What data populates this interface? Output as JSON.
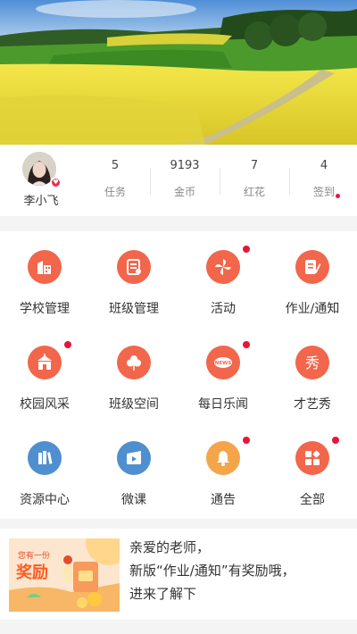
{
  "profile": {
    "name": "李小飞"
  },
  "stats": [
    {
      "value": "5",
      "label": "任务"
    },
    {
      "value": "9193",
      "label": "金币"
    },
    {
      "value": "7",
      "label": "红花"
    },
    {
      "value": "4",
      "label": "签到"
    }
  ],
  "grid": [
    {
      "label": "学校管理",
      "icon": "school-icon",
      "color": "#f2664b"
    },
    {
      "label": "班级管理",
      "icon": "class-management-icon",
      "color": "#f2664b"
    },
    {
      "label": "活动",
      "icon": "activity-pinwheel-icon",
      "color": "#f2664b",
      "dot": true
    },
    {
      "label": "作业/通知",
      "icon": "homework-icon",
      "color": "#f2664b"
    },
    {
      "label": "校园风采",
      "icon": "campus-icon",
      "color": "#f2664b",
      "dot": true
    },
    {
      "label": "班级空间",
      "icon": "clover-icon",
      "color": "#f2664b"
    },
    {
      "label": "每日乐闻",
      "icon": "news-icon",
      "color": "#f2664b",
      "dot": true,
      "icon_text": "NEWS"
    },
    {
      "label": "才艺秀",
      "icon": "talent-show-icon",
      "color": "#f2664b",
      "icon_text": "秀"
    },
    {
      "label": "资源中心",
      "icon": "books-icon",
      "color": "#4f8fcf"
    },
    {
      "label": "微课",
      "icon": "video-icon",
      "color": "#4f8fcf"
    },
    {
      "label": "通告",
      "icon": "bell-icon",
      "color": "#f4a54a",
      "dot": true
    },
    {
      "label": "全部",
      "icon": "all-apps-icon",
      "color": "#f2664b",
      "dot": true
    }
  ],
  "notice": {
    "line1": "亲爱的老师，",
    "line2": "新版“作业/通知”有奖励哦，",
    "line3": "进来了解下",
    "promo_caption": "奖励",
    "promo_small": "您有一份"
  }
}
